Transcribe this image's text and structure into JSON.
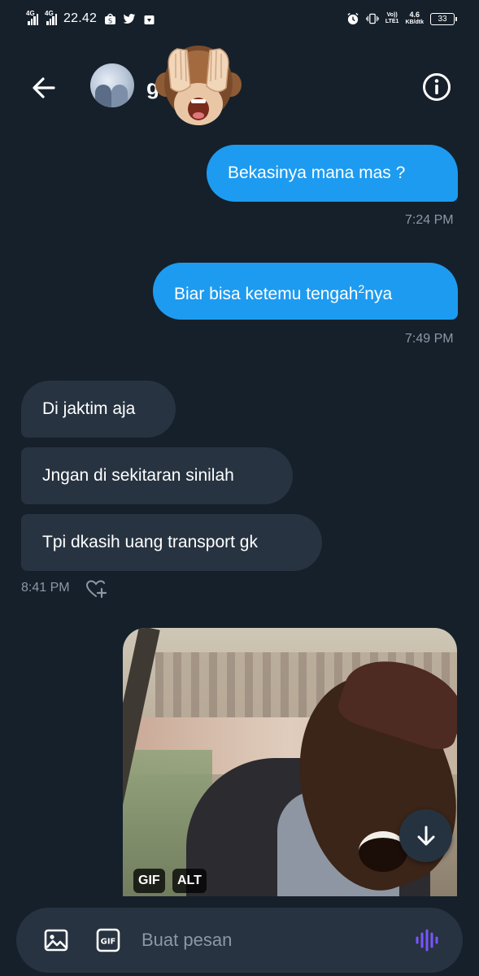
{
  "status_bar": {
    "net1": "4G",
    "net2": "4G",
    "time": "22.42",
    "volte_top": "Vo))",
    "volte_bottom": "LTE1",
    "speed_top": "4.6",
    "speed_bottom": "KB/dtk",
    "battery": "33"
  },
  "header": {
    "contact_name": "ga",
    "back_icon": "arrow-left-icon",
    "info_icon": "info-icon",
    "sticker": "see-no-evil-monkey-emoji"
  },
  "messages": {
    "sent1": {
      "text": "Bekasinya mana mas ?",
      "time": "7:24 PM"
    },
    "sent2": {
      "text_before": "Biar bisa ketemu tengah",
      "sup": "2",
      "text_after": "nya",
      "time": "7:49 PM"
    },
    "recv1": {
      "text": "Di jaktim aja"
    },
    "recv2": {
      "text": "Jngan di sekitaran sinilah"
    },
    "recv3": {
      "text": "Tpi dkasih uang transport gk",
      "time": "8:41 PM"
    }
  },
  "gif": {
    "badge_gif": "GIF",
    "badge_alt": "ALT"
  },
  "composer": {
    "placeholder": "Buat pesan",
    "gif_icon_label": "GIF"
  },
  "colors": {
    "background": "#15202b",
    "sent_bubble": "#1d9bf0",
    "received_bubble": "#273340",
    "timestamp": "#8b98a5",
    "voice_icon": "#7856ff"
  }
}
